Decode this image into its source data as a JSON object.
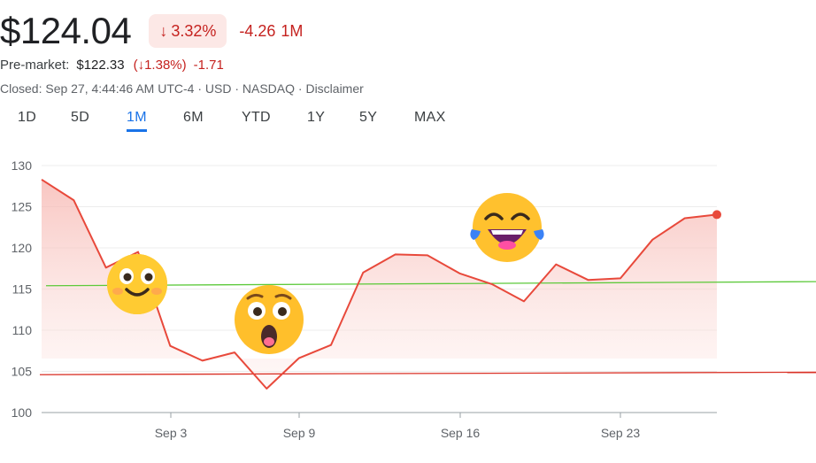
{
  "quote": {
    "price": "$124.04",
    "change_arrow": "↓",
    "change_pct": "3.32%",
    "change_abs": "-4.26",
    "change_period": "1M"
  },
  "premarket": {
    "label": "Pre-market:",
    "price": "$122.33",
    "pct_text": "(↓1.38%)",
    "abs": "-1.71"
  },
  "closed_text": "Closed: Sep 27, 4:44:46 AM UTC-4 · USD · NASDAQ · Disclaimer",
  "tabs": [
    {
      "label": "1D"
    },
    {
      "label": "5D"
    },
    {
      "label": "1M",
      "active": true
    },
    {
      "label": "6M"
    },
    {
      "label": "YTD"
    },
    {
      "label": "1Y"
    },
    {
      "label": "5Y"
    },
    {
      "label": "MAX"
    }
  ],
  "colors": {
    "line": "#e8493b",
    "fill": "#fce8e6",
    "green_line": "#5cc93a",
    "red_line": "#d93025",
    "grid": "#ececec",
    "axis": "#9aa0a6",
    "active_tab": "#1a73e8"
  },
  "chart_data": {
    "type": "area",
    "y_ticks": [
      "130",
      "125",
      "120",
      "115",
      "110",
      "105",
      "100"
    ],
    "ylim": [
      100,
      130
    ],
    "x_ticks": [
      "Sep 3",
      "Sep 9",
      "Sep 16",
      "Sep 23"
    ],
    "series": [
      {
        "values": [
          128.3,
          125.8,
          117.6,
          119.5,
          108.1,
          106.3,
          107.3,
          102.9,
          106.6,
          108.2,
          117.0,
          119.2,
          119.1,
          116.9,
          115.6,
          113.5,
          118.0,
          116.1,
          116.3,
          121.0,
          123.6,
          124.04
        ]
      }
    ],
    "reference_lines": [
      {
        "color": "green",
        "from": 115.4,
        "to": 115.9
      },
      {
        "color": "red",
        "from": 104.6,
        "to": 104.9
      }
    ],
    "annotations": [
      {
        "icon": "smiling-face-emoji"
      },
      {
        "icon": "astonished-face-emoji"
      },
      {
        "icon": "laughing-face-emoji"
      }
    ]
  }
}
